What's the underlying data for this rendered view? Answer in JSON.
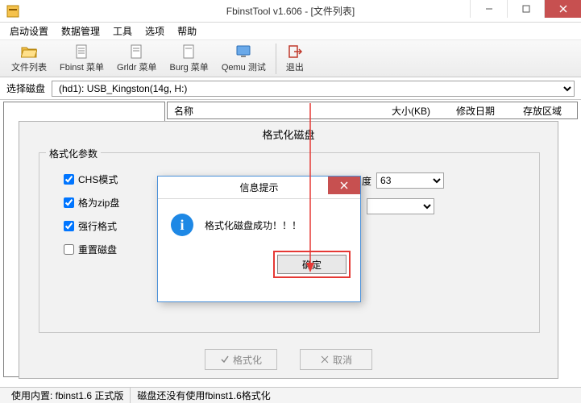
{
  "window": {
    "title": "FbinstTool v1.606 - [文件列表]"
  },
  "menu": {
    "items": [
      "启动设置",
      "数据管理",
      "工具",
      "选项",
      "帮助"
    ]
  },
  "toolbar": {
    "file_list": "文件列表",
    "fbinst_menu": "Fbinst 菜单",
    "grldr_menu": "Grldr 菜单",
    "burg_menu": "Burg 菜单",
    "qemu_test": "Qemu 测试",
    "exit": "退出"
  },
  "disk": {
    "label": "选择磁盘",
    "selected": "(hd1): USB_Kingston(14g, H:)"
  },
  "table": {
    "headers": {
      "name": "名称",
      "size": "大小(KB)",
      "date": "修改日期",
      "area": "存放区域"
    }
  },
  "format_dialog": {
    "title": "格式化磁盘",
    "group": "格式化参数",
    "checks": {
      "chs": "CHS模式",
      "zip": "格为zip盘",
      "force": "强行格式",
      "reset": "重置磁盘"
    },
    "check_values": {
      "chs": true,
      "zip": true,
      "force": true,
      "reset": false
    },
    "right": {
      "degree_label": "度",
      "degree_value": "63",
      "other_label": ""
    },
    "format_btn": "格式化",
    "cancel_btn": "取消"
  },
  "msgbox": {
    "title": "信息提示",
    "text": "格式化磁盘成功！！！",
    "ok": "确定"
  },
  "status": {
    "left": "使用内置: fbinst1.6 正式版",
    "right": "磁盘还没有使用fbinst1.6格式化"
  }
}
